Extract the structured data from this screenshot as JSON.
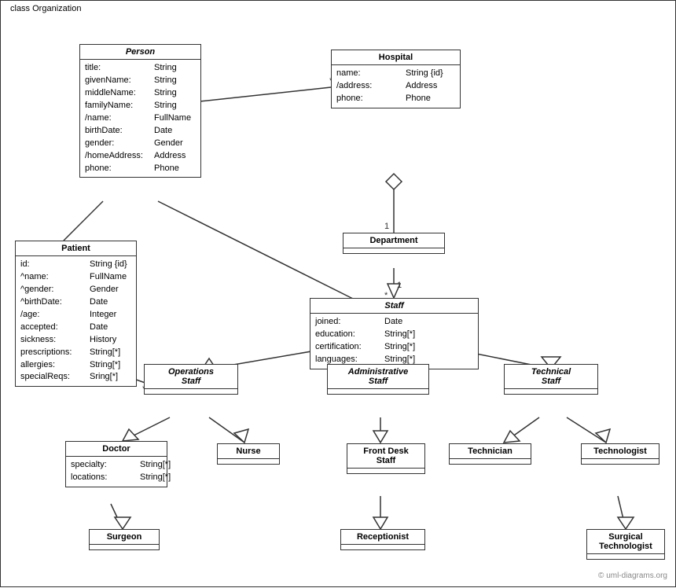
{
  "diagram": {
    "title": "class Organization",
    "watermark": "© uml-diagrams.org",
    "classes": {
      "person": {
        "name": "Person",
        "italic": true,
        "attrs": [
          {
            "name": "title:",
            "type": "String"
          },
          {
            "name": "givenName:",
            "type": "String"
          },
          {
            "name": "middleName:",
            "type": "String"
          },
          {
            "name": "familyName:",
            "type": "String"
          },
          {
            "name": "/name:",
            "type": "FullName"
          },
          {
            "name": "birthDate:",
            "type": "Date"
          },
          {
            "name": "gender:",
            "type": "Gender"
          },
          {
            "name": "/homeAddress:",
            "type": "Address"
          },
          {
            "name": "phone:",
            "type": "Phone"
          }
        ]
      },
      "hospital": {
        "name": "Hospital",
        "italic": false,
        "attrs": [
          {
            "name": "name:",
            "type": "String {id}"
          },
          {
            "name": "/address:",
            "type": "Address"
          },
          {
            "name": "phone:",
            "type": "Phone"
          }
        ]
      },
      "patient": {
        "name": "Patient",
        "italic": false,
        "attrs": [
          {
            "name": "id:",
            "type": "String {id}"
          },
          {
            "name": "^name:",
            "type": "FullName"
          },
          {
            "name": "^gender:",
            "type": "Gender"
          },
          {
            "name": "^birthDate:",
            "type": "Date"
          },
          {
            "name": "/age:",
            "type": "Integer"
          },
          {
            "name": "accepted:",
            "type": "Date"
          },
          {
            "name": "sickness:",
            "type": "History"
          },
          {
            "name": "prescriptions:",
            "type": "String[*]"
          },
          {
            "name": "allergies:",
            "type": "String[*]"
          },
          {
            "name": "specialReqs:",
            "type": "Sring[*]"
          }
        ]
      },
      "department": {
        "name": "Department",
        "italic": false,
        "attrs": []
      },
      "staff": {
        "name": "Staff",
        "italic": true,
        "attrs": [
          {
            "name": "joined:",
            "type": "Date"
          },
          {
            "name": "education:",
            "type": "String[*]"
          },
          {
            "name": "certification:",
            "type": "String[*]"
          },
          {
            "name": "languages:",
            "type": "String[*]"
          }
        ]
      },
      "operations_staff": {
        "name": "Operations Staff",
        "italic": true
      },
      "administrative_staff": {
        "name": "Administrative Staff",
        "italic": true
      },
      "technical_staff": {
        "name": "Technical Staff",
        "italic": true
      },
      "doctor": {
        "name": "Doctor",
        "attrs": [
          {
            "name": "specialty:",
            "type": "String[*]"
          },
          {
            "name": "locations:",
            "type": "String[*]"
          }
        ]
      },
      "nurse": {
        "name": "Nurse",
        "attrs": []
      },
      "front_desk_staff": {
        "name": "Front Desk Staff",
        "attrs": []
      },
      "technician": {
        "name": "Technician",
        "attrs": []
      },
      "technologist": {
        "name": "Technologist",
        "attrs": []
      },
      "surgeon": {
        "name": "Surgeon",
        "attrs": []
      },
      "receptionist": {
        "name": "Receptionist",
        "attrs": []
      },
      "surgical_technologist": {
        "name": "Surgical Technologist",
        "attrs": []
      }
    }
  }
}
